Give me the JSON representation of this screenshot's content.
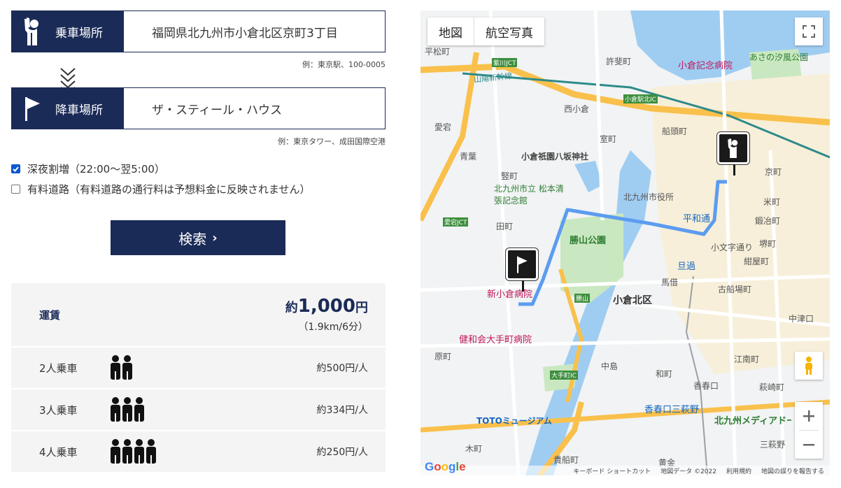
{
  "pickup": {
    "label": "乗車場所",
    "icon": "hand-raised-person-icon",
    "value": "福岡県北九州市小倉北区京町3丁目",
    "example": "例：東京駅、100-0005"
  },
  "dropoff": {
    "label": "降車場所",
    "icon": "flag-icon",
    "value": "ザ・スティール・ハウス",
    "example": "例：東京タワー、成田国際空港"
  },
  "options": {
    "late_night": {
      "label": "深夜割増（22:00～翌5:00）",
      "checked": true
    },
    "toll": {
      "label": "有料道路（有料道路の通行料は予想料金に反映されません）",
      "checked": false
    }
  },
  "search_button": {
    "label": "検索",
    "arrow": "›"
  },
  "fare": {
    "title": "運賃",
    "prefix": "約",
    "amount": "1,000",
    "unit": "円",
    "detail": "（1.9km/6分）",
    "rows": [
      {
        "people": "2人乗車",
        "count": 2,
        "price": "約500円/人"
      },
      {
        "people": "3人乗車",
        "count": 3,
        "price": "約334円/人"
      },
      {
        "people": "4人乗車",
        "count": 4,
        "price": "約250円/人"
      }
    ]
  },
  "map": {
    "tab_map": "地図",
    "tab_satellite": "航空写真",
    "google": "Google",
    "footer": [
      "キーボード ショートカット",
      "地図データ ©2022",
      "利用規約",
      "地図の誤りを報告する"
    ],
    "labels": {
      "l1": "平松町",
      "l2": "許斐町",
      "l3": "小倉記念病院",
      "l4": "あさの汐風公園",
      "l5": "西小倉",
      "l6": "室町",
      "l7": "船頭町",
      "l8": "愛宕",
      "l9": "青葉",
      "l10": "小倉祇園八坂神社",
      "l11": "竪町",
      "l12": "北九州市立 松本清張記念館",
      "l13": "北九州市役所",
      "l14": "京町",
      "l15": "米町",
      "l16": "平和通",
      "l17": "鍛冶町",
      "l18": "田町",
      "l19": "勝山公園",
      "l20": "小文字通り",
      "l21": "堺町",
      "l22": "旦過",
      "l23": "紺屋町",
      "l24": "新小倉病院",
      "l25": "馬借",
      "l26": "古船場町",
      "l27": "小倉北区",
      "l28": "中津口",
      "l29": "健和会大手町病院",
      "l30": "原町",
      "l31": "中島",
      "l32": "江南町",
      "l33": "和町",
      "l34": "香春口",
      "l35": "萩崎町",
      "l36": "香春口三萩野",
      "l37": "TOTOミュージアム",
      "l38": "北九州メディアドーム",
      "l39": "木町",
      "l40": "貴船町",
      "l41": "三萩野",
      "l42": "大手町IC",
      "l43": "勝山",
      "l44": "愛宕JCT",
      "l45": "小倉駅北IC",
      "l46": "紫川JCT",
      "l47": "山陽新幹線",
      "l48": "黄金"
    }
  },
  "colors": {
    "navy": "#1b2b57",
    "route": "#5c9cf0",
    "highway": "#f9c04b",
    "water": "#9fcdf2",
    "park": "#c9e8c1"
  }
}
